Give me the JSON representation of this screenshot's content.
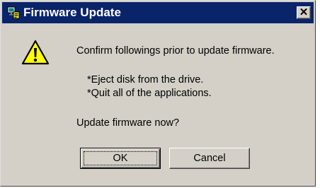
{
  "window": {
    "title": "Firmware Update",
    "title_icon": "monitor-app-icon",
    "close_symbol": "✕"
  },
  "dialog": {
    "icon": "warning-icon",
    "icon_color": "#ffff00",
    "message": "Confirm followings prior to update firmware.",
    "items": [
      "*Eject disk from the drive.",
      "*Quit all of the applications."
    ],
    "question": "Update firmware now?"
  },
  "buttons": {
    "ok_label": "OK",
    "cancel_label": "Cancel"
  },
  "colors": {
    "titlebar": "#0a246a",
    "face": "#d4d0c8"
  }
}
